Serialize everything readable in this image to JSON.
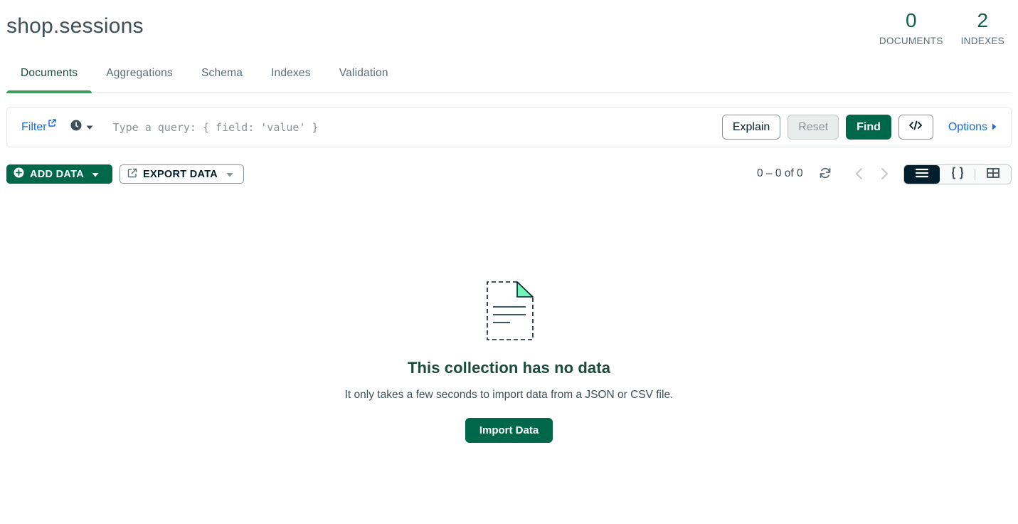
{
  "collection": {
    "database": "shop",
    "separator": ".",
    "name": "sessions"
  },
  "stats": [
    {
      "value": "0",
      "label": "DOCUMENTS"
    },
    {
      "value": "2",
      "label": "INDEXES"
    }
  ],
  "tabs": [
    {
      "label": "Documents",
      "active": true
    },
    {
      "label": "Aggregations"
    },
    {
      "label": "Schema"
    },
    {
      "label": "Indexes"
    },
    {
      "label": "Validation"
    }
  ],
  "query_bar": {
    "filter_label": "Filter",
    "placeholder": "Type a query: { field: 'value' }",
    "explain_label": "Explain",
    "reset_label": "Reset",
    "find_label": "Find",
    "options_label": "Options"
  },
  "toolbar": {
    "add_data_label": "ADD DATA",
    "export_data_label": "EXPORT DATA",
    "pagination_text": "0 – 0 of 0"
  },
  "empty_state": {
    "title": "This collection has no data",
    "description": "It only takes a few seconds to import data from a JSON or CSV file.",
    "import_label": "Import Data"
  },
  "colors": {
    "brand_green": "#00684a",
    "accent_green": "#3e9f5c",
    "link_blue": "#1a6bd6",
    "dark": "#001e2b"
  },
  "icons": [
    "external-link-icon",
    "clock-icon",
    "caret-down-icon",
    "code-icon",
    "caret-right-icon",
    "plus-circle-icon",
    "export-icon",
    "refresh-icon",
    "chevron-left-icon",
    "chevron-right-icon",
    "list-view-icon",
    "json-view-icon",
    "table-view-icon",
    "empty-document-icon"
  ]
}
